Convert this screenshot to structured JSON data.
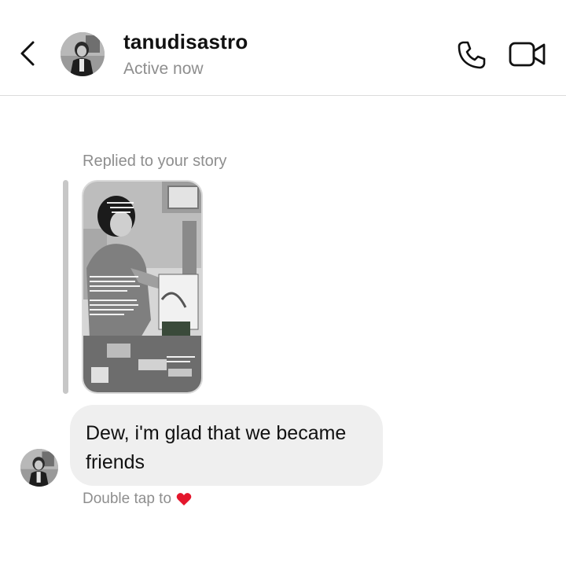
{
  "header": {
    "username": "tanudisastro",
    "status": "Active now"
  },
  "icons": {
    "back": "chevron-left-icon",
    "phone": "phone-icon",
    "video": "video-camera-icon",
    "heart": "heart-icon"
  },
  "conversation": {
    "reply_label": "Replied to your story",
    "message": "Dew, i'm glad that we became friends",
    "double_tap_label": "Double tap to"
  },
  "colors": {
    "accent_text": "#111111",
    "secondary_text": "#8e8e8e",
    "bubble_bg": "#efefef",
    "heart": "#e4162c"
  }
}
